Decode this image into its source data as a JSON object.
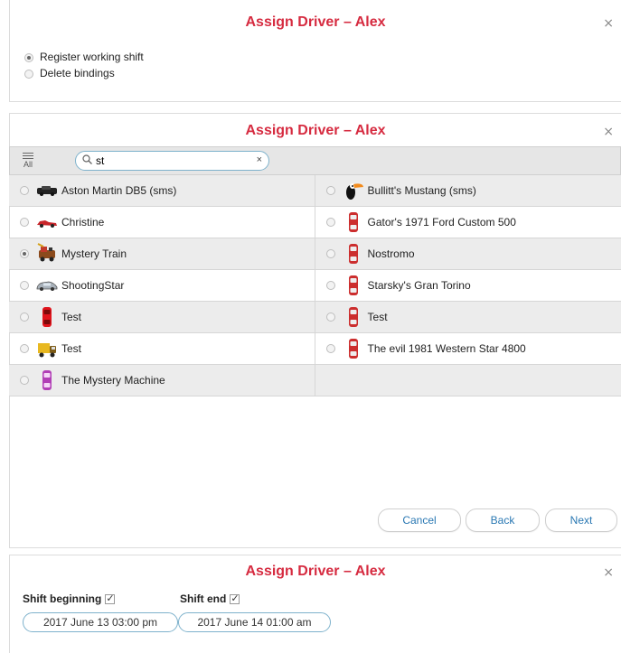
{
  "dialog1": {
    "title": "Assign Driver – Alex",
    "close": "×",
    "options": [
      "Register working shift",
      "Delete bindings"
    ]
  },
  "dialog2": {
    "title": "Assign Driver – Alex",
    "close": "×",
    "all_label": "All",
    "search_value": "st",
    "clear": "×",
    "units": [
      {
        "label": "Aston Martin DB5 (sms)",
        "icon": "black-car-icon",
        "selected": false
      },
      {
        "label": "Bullitt's Mustang (sms)",
        "icon": "toucan-icon",
        "selected": false
      },
      {
        "label": "Christine",
        "icon": "red-car-icon",
        "selected": false
      },
      {
        "label": "Gator's 1971 Ford Custom 500",
        "icon": "red-car-topview-icon",
        "selected": false
      },
      {
        "label": "Mystery Train",
        "icon": "train-icon",
        "selected": true
      },
      {
        "label": "Nostromo",
        "icon": "red-car-topview-icon",
        "selected": false
      },
      {
        "label": "ShootingStar",
        "icon": "silver-car-icon",
        "selected": false
      },
      {
        "label": "Starsky's Gran Torino",
        "icon": "red-car-topview-icon",
        "selected": false
      },
      {
        "label": "Test",
        "icon": "red-car-topview-icon",
        "selected": false
      },
      {
        "label": "Test",
        "icon": "red-car-topview-icon",
        "selected": false
      },
      {
        "label": "Test",
        "icon": "yellow-truck-icon",
        "selected": false
      },
      {
        "label": "The evil 1981 Western Star 4800",
        "icon": "red-car-topview-icon",
        "selected": false
      },
      {
        "label": "The Mystery Machine",
        "icon": "purple-car-topview-icon",
        "selected": false
      }
    ],
    "buttons": {
      "cancel": "Cancel",
      "back": "Back",
      "next": "Next"
    }
  },
  "dialog3": {
    "title": "Assign Driver – Alex",
    "close": "×",
    "shift_beginning_label": "Shift beginning",
    "shift_end_label": "Shift end",
    "shift_beginning_value": "2017 June 13 03:00 pm",
    "shift_end_value": "2017 June 14 01:00 am"
  },
  "colors": {
    "title": "#d62b40",
    "link": "#2a78b3",
    "field_border": "#7eb2cc"
  }
}
